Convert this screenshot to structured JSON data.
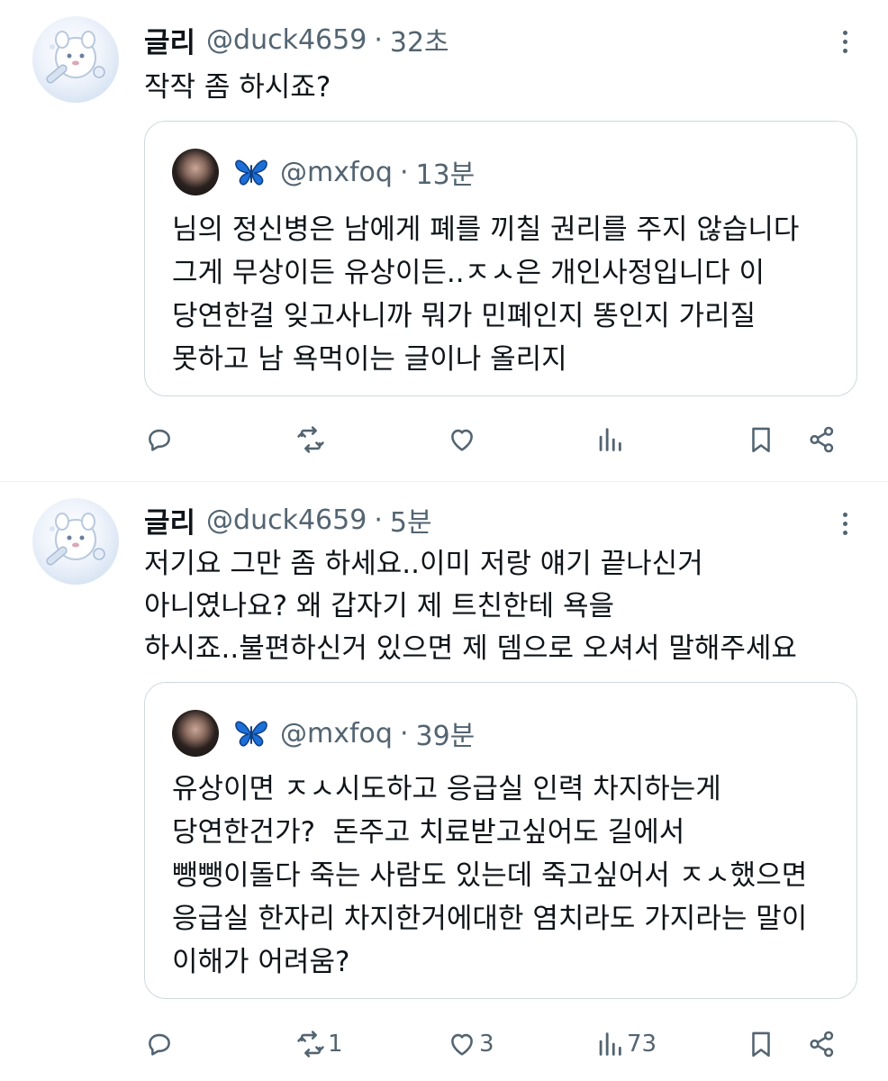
{
  "tweets": [
    {
      "name": "글리",
      "handle": "@duck4659",
      "separator": "·",
      "time": "32초",
      "text": "작작 좀 하시죠?",
      "quote": {
        "badge": "🦋",
        "handle": "@mxfoq",
        "separator": "·",
        "time": "13분",
        "text": "님의 정신병은 남에게 폐를 끼칠 권리를 주지 않습니다\n그게 무상이든 유상이든..ㅈㅅ은 개인사정입니다 이\n당연한걸 잊고사니까 뭐가 민폐인지 똥인지 가리질\n못하고 남 욕먹이는 글이나 올리지"
      },
      "actions": {
        "reply": "",
        "retweet": "",
        "like": "",
        "views": ""
      }
    },
    {
      "name": "글리",
      "handle": "@duck4659",
      "separator": "·",
      "time": "5분",
      "text": "저기요 그만 좀 하세요..이미 저랑 얘기 끝나신거\n아니였나요? 왜 갑자기 제 트친한테 욕을\n하시죠..불편하신거 있으면 제 뎀으로 오셔서 말해주세요",
      "quote": {
        "badge": "🦋",
        "handle": "@mxfoq",
        "separator": "·",
        "time": "39분",
        "text": "유상이면 ㅈㅅ시도하고 응급실 인력 차지하는게\n당연한건가?  돈주고 치료받고싶어도 길에서\n뺑뺑이돌다 죽는 사람도 있는데 죽고싶어서 ㅈㅅ했으면\n응급실 한자리 차지한거에대한 염치라도 가지라는 말이\n이해가 어려움?"
      },
      "actions": {
        "reply": "",
        "retweet": "1",
        "like": "3",
        "views": "73"
      }
    }
  ],
  "colors": {
    "text": "#0f1419",
    "secondary": "#536471",
    "border": "#cfd9de",
    "divider": "#eff3f4",
    "butterfly": "#1d6fd8"
  },
  "icons": [
    "more-icon",
    "reply-icon",
    "retweet-icon",
    "like-icon",
    "views-icon",
    "bookmark-icon",
    "share-icon",
    "butterfly-icon"
  ]
}
